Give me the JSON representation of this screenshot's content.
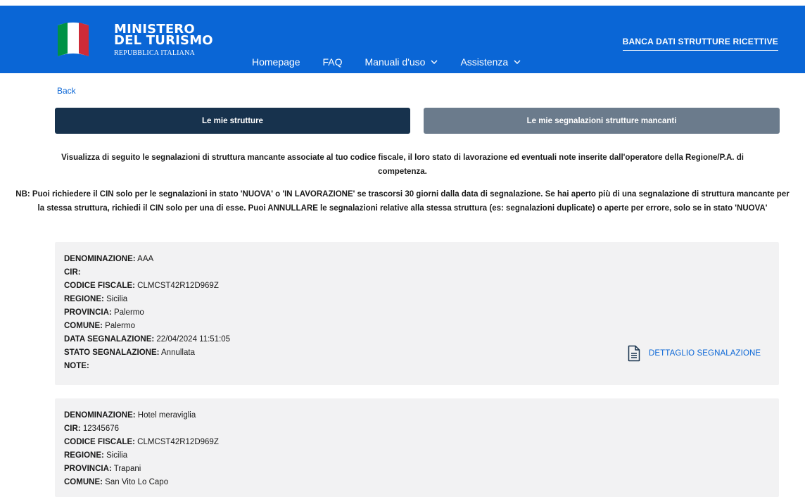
{
  "header": {
    "logo_line1": "MINISTERO",
    "logo_line2": "DEL TURISMO",
    "logo_sub": "REPUBBLICA ITALIANA",
    "nav": [
      "Homepage",
      "FAQ",
      "Manuali d'uso",
      "Assistenza"
    ],
    "right_link": "BANCA DATI STRUTTURE RICETTIVE",
    "bg_color": "#0a66d6"
  },
  "back_label": "Back",
  "tabs": {
    "active": "Le mie strutture",
    "inactive": "Le mie segnalazioni strutture mancanti"
  },
  "info": {
    "line1": "Visualizza di seguito le segnalazioni di struttura mancante associate al tuo codice fiscale, il loro stato di lavorazione ed eventuali note inserite dall'operatore della Regione/P.A. di competenza.",
    "line2": "NB: Puoi richiedere il CIN solo per le segnalazioni in stato 'NUOVA' o 'IN LAVORAZIONE' se trascorsi 30 giorni dalla data di segnalazione. Se hai aperto più di una segnalazione di struttura mancante per la stessa struttura, richiedi il CIN solo per una di esse. Puoi ANNULLARE le segnalazioni relative alla stessa struttura (es: segnalazioni duplicate) o aperte per errore, solo se in stato 'NUOVA'"
  },
  "labels": {
    "denominazione": "DENOMINAZIONE:",
    "cir": "CIR:",
    "codice_fiscale": "CODICE FISCALE:",
    "regione": "REGIONE:",
    "provincia": "PROVINCIA:",
    "comune": "COMUNE:",
    "data": "DATA SEGNALAZIONE:",
    "stato": "STATO SEGNALAZIONE:",
    "note": "NOTE:"
  },
  "detail_label": "DETTAGLIO SEGNALAZIONE",
  "cards": [
    {
      "denominazione": "AAA",
      "cir": "",
      "codice_fiscale": "CLMCST42R12D969Z",
      "regione": "Sicilia",
      "provincia": "Palermo",
      "comune": "Palermo",
      "data": "22/04/2024 11:51:05",
      "stato": "Annullata",
      "note": ""
    },
    {
      "denominazione": "Hotel meraviglia",
      "cir": "12345676",
      "codice_fiscale": "CLMCST42R12D969Z",
      "regione": "Sicilia",
      "provincia": "Trapani",
      "comune": "San Vito Lo Capo"
    }
  ]
}
